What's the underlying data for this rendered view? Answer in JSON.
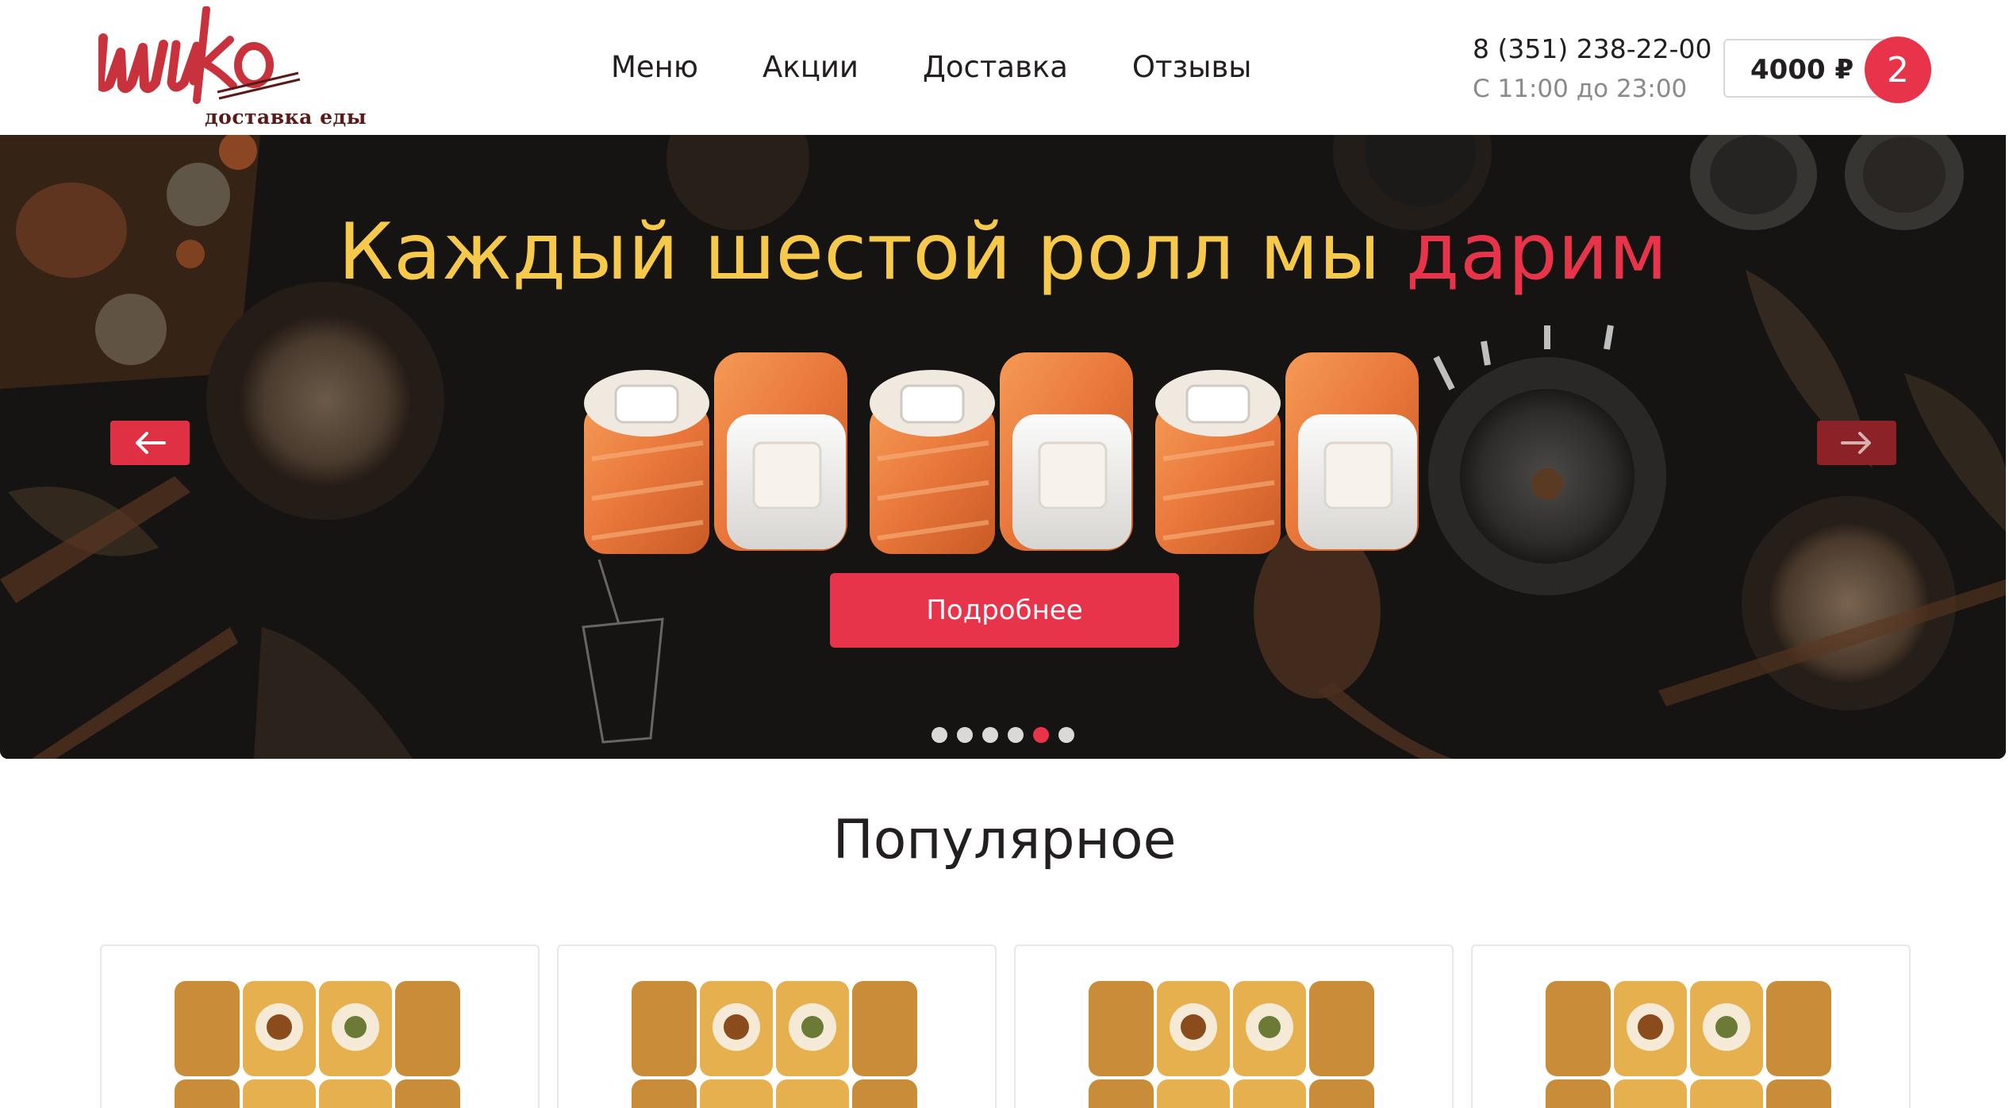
{
  "header": {
    "logo_sub": "доставка еды",
    "nav": [
      "Меню",
      "Акции",
      "Доставка",
      "Отзывы"
    ],
    "phone": "8 (351) 238-22-00",
    "hours": "С 11:00 до 23:00",
    "cart_price": "4000 ₽",
    "cart_count": "2"
  },
  "banner": {
    "title_main": "Каждый шестой ролл мы ",
    "title_accent": "дарим",
    "button": "Подробнее",
    "slides_total": 6,
    "active_slide": 5
  },
  "popular": {
    "title": "Популярное",
    "cards_count": 4
  },
  "colors": {
    "accent": "#e8344a",
    "title_yellow": "#f7c94b",
    "banner_bg": "#151312"
  },
  "icons": {
    "arrow_left": "arrow-left-icon",
    "arrow_right": "arrow-right-icon"
  }
}
